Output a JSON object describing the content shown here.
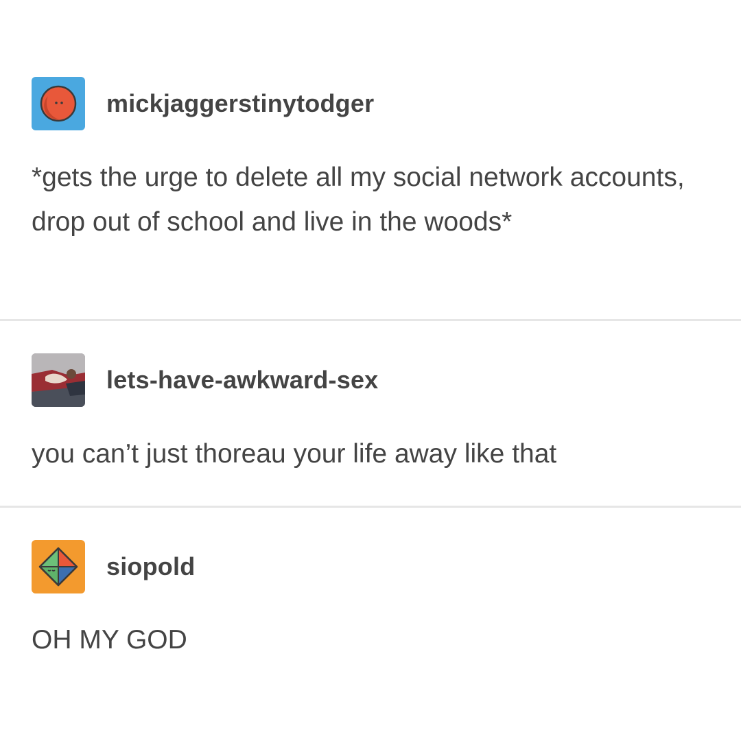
{
  "posts": [
    {
      "username": "mickjaggerstinytodger",
      "avatar_icon": "red-face-circle-avatar-icon",
      "avatar_bg": "#4aa8e0",
      "text": "*gets the urge to delete all my social network accounts, drop out of school and live in the woods*"
    },
    {
      "username": "lets-have-awkward-sex",
      "avatar_icon": "photo-avatar-icon",
      "text": "you can’t just thoreau your life away like that"
    },
    {
      "username": "siopold",
      "avatar_icon": "diamond-face-avatar-icon",
      "avatar_bg": "#f39a2e",
      "text": "OH MY GOD"
    }
  ],
  "colors": {
    "text": "#444444",
    "divider": "#e6e6e6",
    "background": "#ffffff"
  }
}
